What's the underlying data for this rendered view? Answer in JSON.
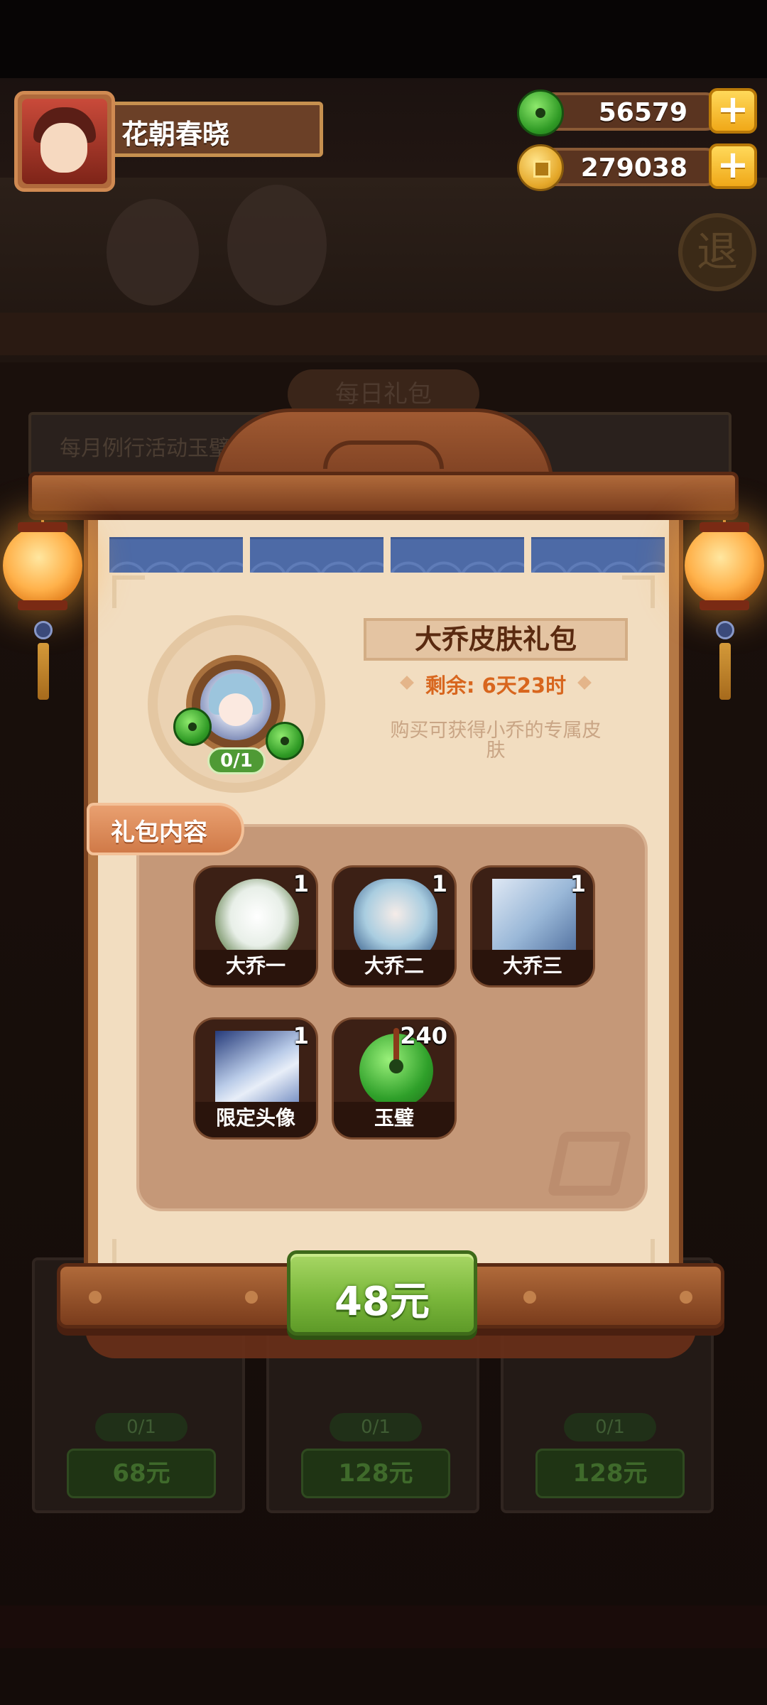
{
  "player": {
    "name": "花朝春晓",
    "avatar_icon": "player-avatar"
  },
  "currency": {
    "jade": {
      "icon": "jade-bi-icon",
      "amount": "56579"
    },
    "coins": {
      "icon": "gold-coin-icon",
      "amount": "279038"
    }
  },
  "background": {
    "tab_label": "每日礼包",
    "banner_text": "每月例行活动玉璧包",
    "retreat_button": "退",
    "cards": [
      {
        "count": "0/1",
        "price": "68元"
      },
      {
        "count": "0/1",
        "price": "128元"
      },
      {
        "count": "0/1",
        "price": "128元"
      }
    ]
  },
  "dialog": {
    "title": "大乔皮肤礼包",
    "remaining": "剩余: 6天23时",
    "description": "购买可获得小乔的专属皮肤",
    "emblem_count": "0/1",
    "contents_tab": "礼包内容",
    "items": [
      {
        "label": "大乔一",
        "qty": "1",
        "icon": "skin-icon"
      },
      {
        "label": "大乔二",
        "qty": "1",
        "icon": "skin-icon"
      },
      {
        "label": "大乔三",
        "qty": "1",
        "icon": "skin-icon"
      },
      {
        "label": "限定头像",
        "qty": "1",
        "icon": "avatar-icon"
      },
      {
        "label": "玉璧",
        "qty": "240",
        "icon": "jade-bi-icon"
      }
    ],
    "price": "48元"
  },
  "colors": {
    "accent_green": "#7bb83c",
    "timer_orange": "#d8661e",
    "wood": "#7c3f1f",
    "parchment": "#f2ddc0"
  }
}
